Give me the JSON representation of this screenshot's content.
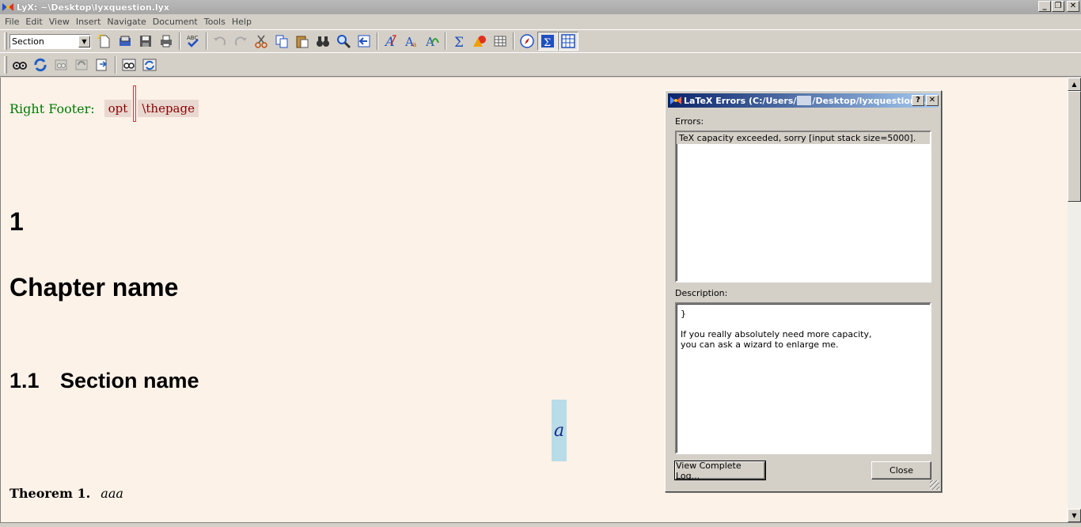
{
  "window": {
    "title": "LyX: ~\\Desktop\\lyxquestion.lyx",
    "minimize": "_",
    "restore": "❐",
    "close": "✕"
  },
  "menu": [
    "File",
    "Edit",
    "View",
    "Insert",
    "Navigate",
    "Document",
    "Tools",
    "Help"
  ],
  "toolbar": {
    "layout_value": "Section"
  },
  "document": {
    "footer_label": "Right Footer:",
    "footer_opt": "opt",
    "footer_value": "\\thepage",
    "chapter_number": "1",
    "chapter_name": "Chapter name",
    "section_number": "1.1",
    "section_name": "Section name",
    "math_inset": "a",
    "theorem_label": "Theorem 1.",
    "theorem_body": "aaa"
  },
  "dialog": {
    "title_prefix": "LaTeX Errors (C:/Users/",
    "title_suffix": "/Desktop/lyxquestion....",
    "help_button": "?",
    "close_x": "✕",
    "errors_label": "Errors:",
    "errors": [
      "TeX capacity exceeded, sorry [input stack size=5000]."
    ],
    "description_label": "Description:",
    "description_lines": [
      "}",
      "",
      "If you really absolutely need more capacity,",
      "you can ask a wizard to enlarge me."
    ],
    "view_log_button": "View Complete Log...",
    "close_button": "Close"
  },
  "colors": {
    "workarea_bg": "#fdf2e8",
    "footer_label": "#007a00",
    "ert_text": "#8b0000",
    "math_bg": "#b8dce8",
    "dialog_title_start": "#0a246a"
  }
}
